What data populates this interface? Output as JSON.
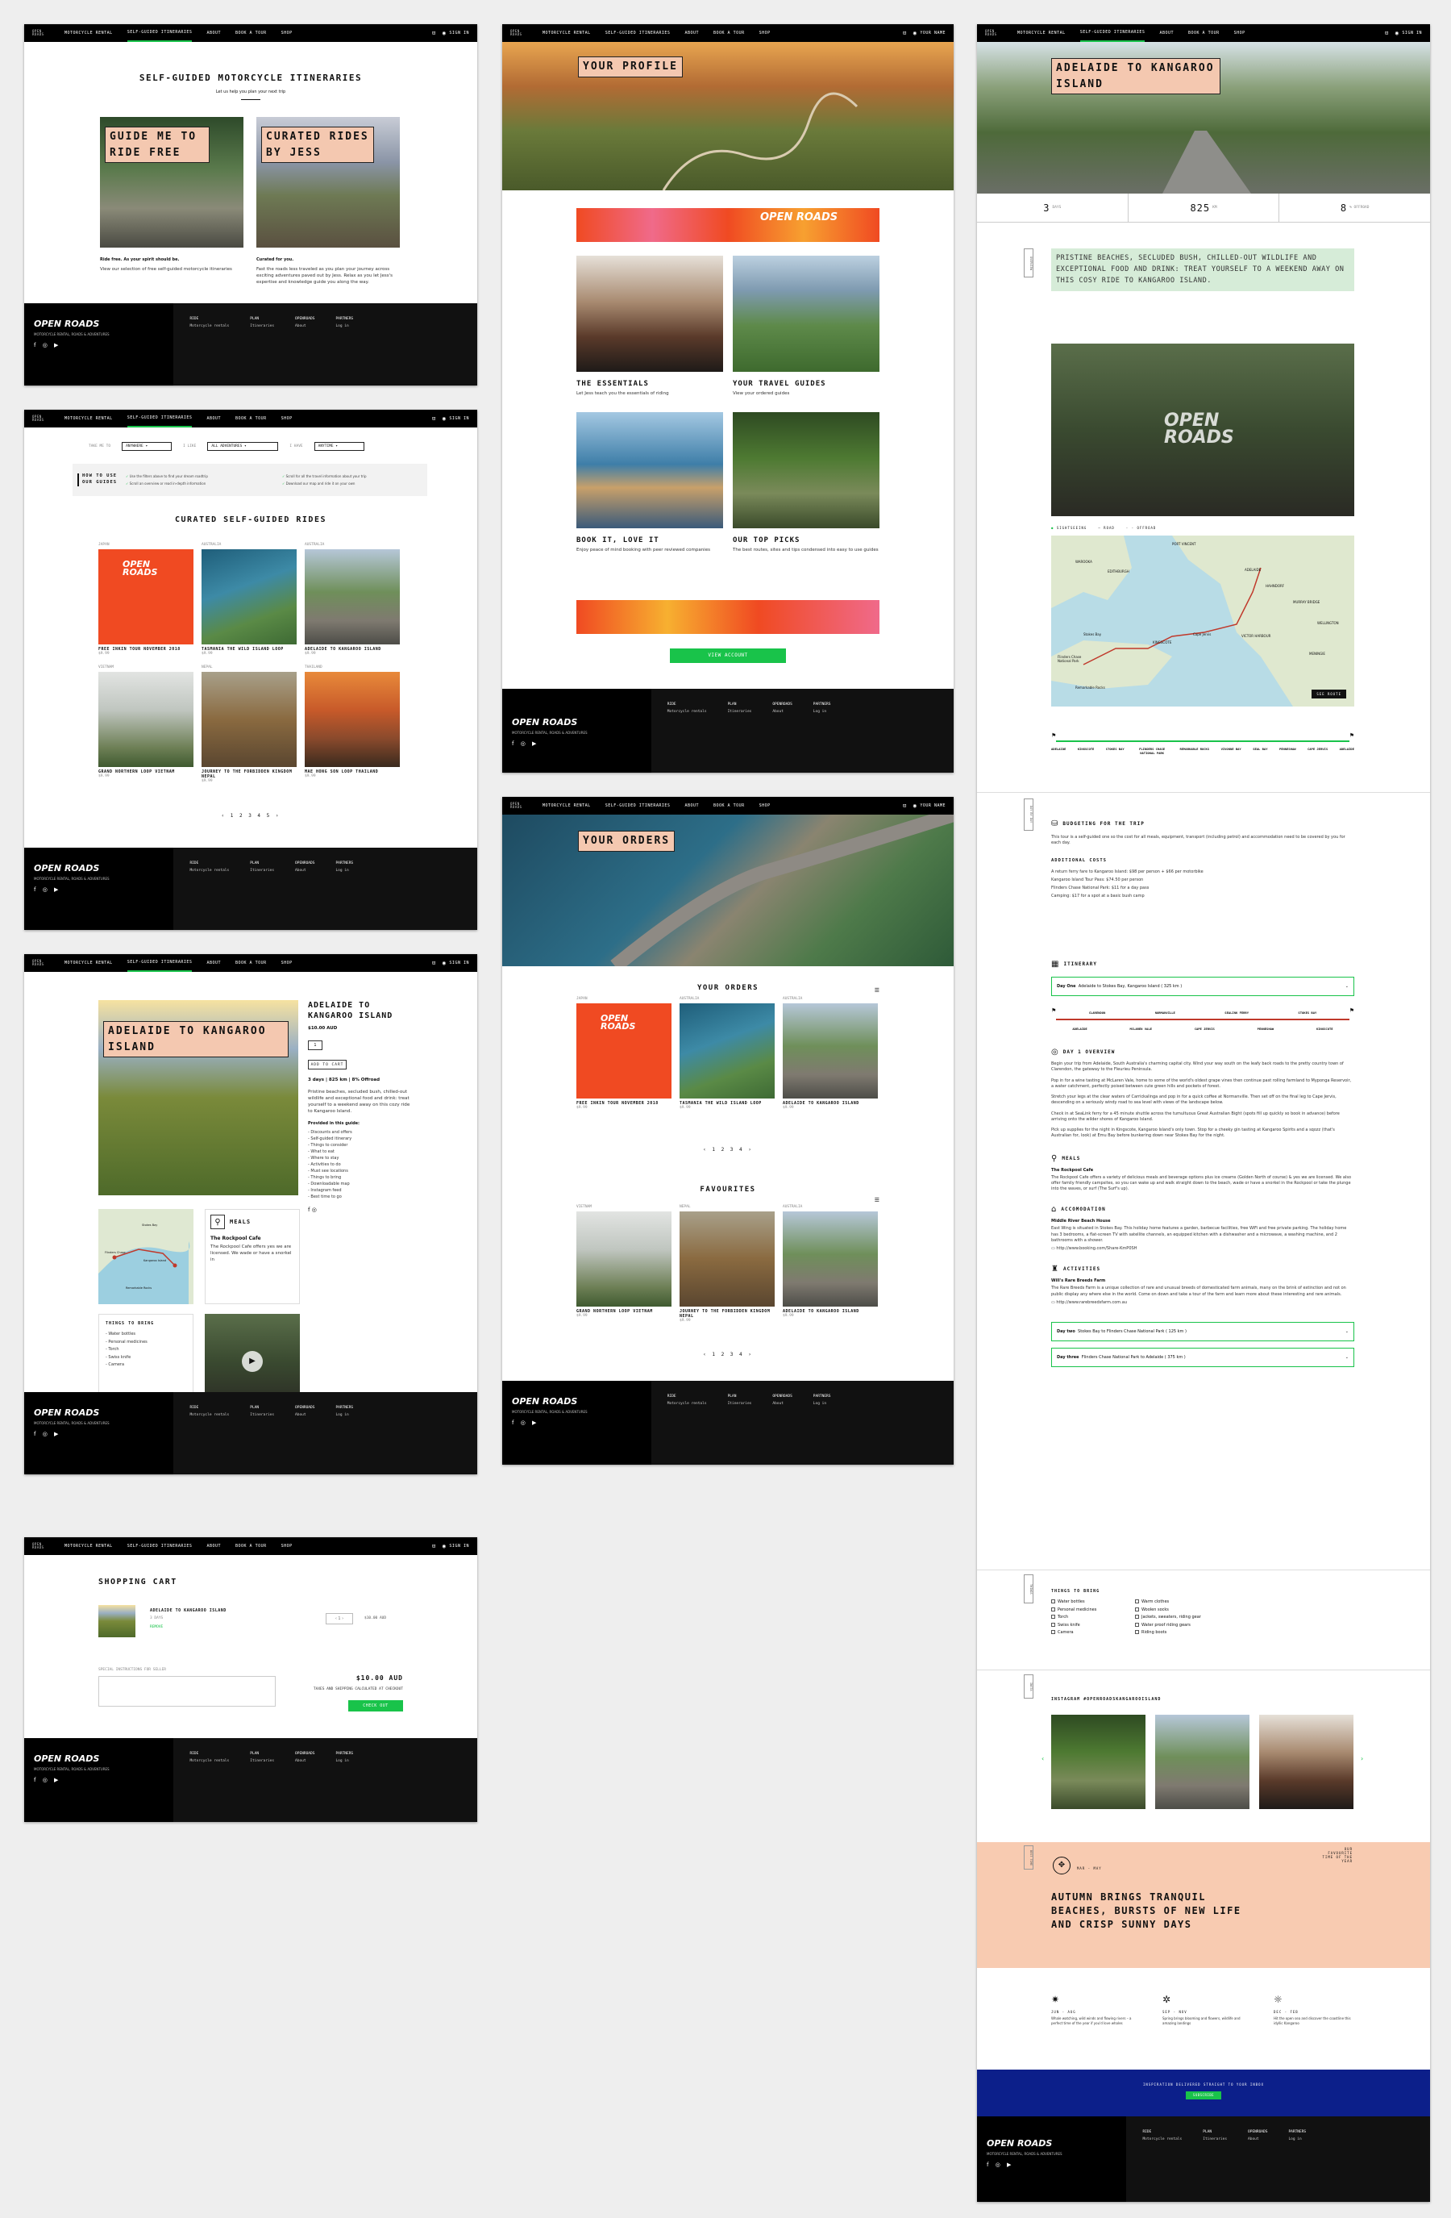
{
  "nav": {
    "brand": "OPEN ROADS",
    "items": [
      "MOTORCYCLE RENTAL",
      "SELF-GUIDED ITINERARIES",
      "ABOUT",
      "BOOK A TOUR",
      "SHOP"
    ],
    "sign_in": "SIGN IN",
    "your_name": "YOUR NAME"
  },
  "footer": {
    "logo": "OPEN ROADS",
    "tagline": "MOTORCYCLE RENTAL, ROADS & ADVENTURES",
    "socials": "f ◎ ▶",
    "cols": [
      {
        "head": "RIDE",
        "link": "Motorcycle rentals"
      },
      {
        "head": "PLAN",
        "link": "Itineraries"
      },
      {
        "head": "OPENROADS",
        "link": "About"
      },
      {
        "head": "PARTNERS",
        "link": "Log in"
      }
    ]
  },
  "s1": {
    "title": "SELF-GUIDED MOTORCYCLE ITINERARIES",
    "sub": "Let us help you plan your next trip",
    "card1_title": "GUIDE ME TO RIDE FREE",
    "card1_head": "Ride free. As your spirit should be.",
    "card1_text": "View our selection of free self-guided motorcycle itineraries",
    "card2_title": "CURATED RIDES BY JESS",
    "card2_head": "Curated for you.",
    "card2_text": "Fast the roads less traveled as you plan your journey across exciting adventures paved out by Jess. Relax as you let Jess's expertise and knowledge guide you along the way."
  },
  "s2": {
    "filter_label1": "TAKE ME TO",
    "filter_val1": "ANYWHERE",
    "filter_label2": "I LIKE",
    "filter_val2": "ALL ADVENTURES",
    "filter_label3": "I HAVE",
    "filter_val3": "ANYTIME",
    "howto_title": "HOW TO USE OUR GUIDES",
    "howto_items": [
      "Use the filters above to find your dream roadtrip",
      "Scroll an overview or read in-depth information",
      "Scroll for all the travel information about your trip",
      "Download our map and ride it on your own"
    ],
    "title": "CURATED SELF-GUIDED RIDES",
    "rides": [
      {
        "region": "JAPAN",
        "name": "FREE INKIN TOUR NOVEMBER 2018",
        "meta": "$9.99"
      },
      {
        "region": "AUSTRALIA",
        "name": "TASMANIA THE WILD ISLAND LOOP",
        "meta": "$9.99"
      },
      {
        "region": "AUSTRALIA",
        "name": "ADELAIDE TO KANGAROO ISLAND",
        "meta": "$9.99"
      },
      {
        "region": "VIETNAM",
        "name": "GRAND NORTHERN LOOP VIETNAM",
        "meta": "$9.99"
      },
      {
        "region": "NEPAL",
        "name": "JOURNEY TO THE FORBIDDEN KINGDOM NEPAL",
        "meta": "$9.99"
      },
      {
        "region": "THAILAND",
        "name": "MAE HONG SON LOOP THAILAND",
        "meta": "$9.99"
      }
    ],
    "pager": "‹ 1 2 3 4 5 ›"
  },
  "s3": {
    "hero_title": "ADELAIDE TO KANGAROO ISLAND",
    "title": "ADELAIDE TO KANGAROO ISLAND",
    "price": "$10.00 AUD",
    "qty": "1",
    "add_btn": "ADD TO CART",
    "stats": "3 days | 825 km | 8% Offroad",
    "desc": "Pristine beaches, secluded bush, chilled-out wildlife and exceptional food and drink: treat yourself to a weekend away on this cozy ride to Kangaroo Island.",
    "provided_title": "Provided in this guide:",
    "provided": [
      "Discounts and offers",
      "Self-guided itinerary",
      "Things to consider",
      "What to eat",
      "Where to stay",
      "Activities to do",
      "Must see locations",
      "Things to bring",
      "Downloadable map",
      "Instagram feed",
      "Best time to go"
    ],
    "meals_title": "MEALS",
    "meals_place": "The Rockpool Cafe",
    "meals_text": "The Rockpool Cafe offers yes we are licensed. We wade or have a snorkel in",
    "bring_title": "THINGS TO BRING",
    "bring": [
      "Water bottles",
      "Personal medicines",
      "Torch",
      "Swiss knife",
      "Camera"
    ],
    "map_labels": [
      "Stokes Bay",
      "Flinders Chase",
      "Kangaroo Island",
      "Remarkable Rocks"
    ]
  },
  "s4": {
    "title": "SHOPPING CART",
    "item_name": "ADELAIDE TO KANGAROO ISLAND",
    "item_days": "3 DAYS",
    "item_status": "REMOVE",
    "item_qty": "1",
    "item_price": "$10.00 AUD",
    "special_label": "SPECIAL INSTRUCTIONS FOR SELLER",
    "total": "$10.00 AUD",
    "tax_note": "TAXES AND SHIPPING CALCULATED AT CHECKOUT",
    "checkout": "CHECK OUT"
  },
  "s5": {
    "hero_title": "YOUR PROFILE",
    "cards": [
      {
        "title": "THE ESSENTIALS",
        "text": "Let Jess teach you the essentials of riding"
      },
      {
        "title": "YOUR TRAVEL GUIDES",
        "text": "View your ordered guides"
      },
      {
        "title": "BOOK IT, LOVE IT",
        "text": "Enjoy peace of mind booking with peer reviewed companies"
      },
      {
        "title": "OUR TOP PICKS",
        "text": "The best routes, sites and tips condensed into easy to use guides"
      }
    ],
    "banner_logo": "OPEN ROADS",
    "view_btn": "VIEW ACCOUNT"
  },
  "s6": {
    "hero_title": "YOUR ORDERS",
    "orders_title": "YOUR ORDERS",
    "orders": [
      {
        "region": "JAPAN",
        "name": "FREE INKIN TOUR NOVEMBER 2018",
        "meta": "$9.99"
      },
      {
        "region": "AUSTRALIA",
        "name": "TASMANIA THE WILD ISLAND LOOP",
        "meta": "$9.99"
      },
      {
        "region": "AUSTRALIA",
        "name": "ADELAIDE TO KANGAROO ISLAND",
        "meta": "$9.99"
      }
    ],
    "fav_title": "FAVOURITES",
    "favs": [
      {
        "region": "VIETNAM",
        "name": "GRAND NORTHERN LOOP VIETNAM",
        "meta": "$9.99"
      },
      {
        "region": "NEPAL",
        "name": "JOURNEY TO THE FORBIDDEN KINGDOM NEPAL",
        "meta": "$9.99"
      },
      {
        "region": "AUSTRALIA",
        "name": "ADELAIDE TO KANGAROO ISLAND",
        "meta": "$9.99"
      }
    ],
    "pager": "‹ 1 2 3 4 ›"
  },
  "s7": {
    "hero_title": "ADELAIDE TO KANGAROO ISLAND",
    "stat1": "3",
    "stat1_unit": "DAYS",
    "stat2": "825",
    "stat2_unit": "KM",
    "stat3": "8",
    "stat3_unit": "% OFFROAD",
    "intro": "PRISTINE BEACHES, SECLUDED BUSH, CHILLED-OUT WILDLIFE AND EXCEPTIONAL FOOD AND DRINK: TREAT YOURSELF TO A WEEKEND AWAY ON THIS COSY RIDE TO KANGAROO ISLAND.",
    "legend": [
      "SIGHTSEEING",
      "ROAD",
      "OFFROAD"
    ],
    "map_places": [
      "PORT VINCENT",
      "WAROOKA",
      "EDITHBURGH",
      "ADELAIDE",
      "HAHNDORF",
      "MURRAY BRIDGE",
      "WELLINGTON",
      "VICTOR HARBOUR",
      "MENINGIE",
      "KINGSCOTE",
      "Stokes Bay",
      "Cape Jervis",
      "Flinders Chase National Park",
      "Remarkable Rocks"
    ],
    "map_btn": "SEE ROUTE",
    "route": [
      "ADELAIDE",
      "KINGSCOTE",
      "STOKES BAY",
      "FLINDERS CHASE NATIONAL PARK",
      "REMARKABLE ROCKS",
      "VIVONNE BAY",
      "SEAL BAY",
      "PENNESHAW",
      "CAPE JERVIS",
      "ADELAIDE"
    ],
    "budget_title": "BUDGETING FOR THE TRIP",
    "budget_text": "This tour is a self-guided one so the cost for all meals, equipment, transport (including petrol) and accommodation need to be covered by you for each day.",
    "costs_title": "ADDITIONAL COSTS",
    "costs": [
      "A return ferry fare to Kangaroo Island: $98 per person + $66 per motorbike",
      "Kangaroo Island Tour Pass: $74.50 per person",
      "Flinders Chase National Park: $11 for a day pass",
      "Camping: $17 for a spot at a basic bush camp"
    ],
    "itin_title": "ITINERARY",
    "day1_label": "Day One",
    "day1_route": "Adelaide to Stokes Bay, Kangaroo Island ( 325 km )",
    "day1_stops": [
      "ADELAIDE",
      "CLARENDON",
      "MCLAREN VALE",
      "NORMANVILLE",
      "CAPE JERVIS",
      "PENNESHAW",
      "SEALINK FERRY",
      "KINGSCOTE",
      "STOKES BAY"
    ],
    "overview_title": "DAY 1 OVERVIEW",
    "overview_p": [
      "Begin your trip from Adelaide, South Australia's charming capital city. Wind your way south on the leafy back roads to the pretty country town of Clarendon, the gateway to the Fleurieu Peninsula.",
      "Pop in for a wine tasting at McLaren Vale, home to some of the world's oldest grape vines then continue past rolling farmland to Myponga Reservoir, a water catchment, perfectly poised between cute green hills and pockets of forest.",
      "Stretch your legs at the clear waters of Carrickalinga and pop in for a quick coffee at Normanville. Then set off on the final leg to Cape Jervis, descending on a seriously windy road to sea level with views of the landscape below.",
      "Check in at SeaLink ferry for a 45 minute shuttle across the tumultuous Great Australian Bight (spots fill up quickly so book in advance) before arriving onto the wilder shores of Kangaroo Island.",
      "Pick up supplies for the night in Kingscote, Kangaroo Island's only town. Stop for a cheeky gin tasting at Kangaroo Spirits and a sqozz (that's Australian for, look) at Emu Bay before bunkering down near Stokes Bay for the night."
    ],
    "meals_title": "MEALS",
    "meals_place": "The Rockpool Cafe",
    "meals_text": "The Rockpool Cafe offers a variety of delicious meals and beverage options plus ice creams (Golden North of course) & yes we are licensed. We also offer family friendly campsites, so you can wake up and walk straight down to the beach, wade or have a snorkel in the Rockpool or take the plunge into the waves, or surf (The Surf's up).",
    "acc_title": "ACCOMODATION",
    "acc_place": "Middle River Beach House",
    "acc_text": "East Wing is situated in Stokes Bay. This holiday home features a garden, barbecue facilities, free WiFi and free private parking. The holiday home has 3 bedrooms, a flat-screen TV with satellite channels, an equipped kitchen with a dishwasher and a microwave, a washing machine, and 2 bathrooms with a shower.",
    "acc_link": "http://www.booking.com/Share-KmP0SH",
    "act_title": "ACTIVITIES",
    "act_place": "Will's Rare Breeds Farm",
    "act_text": "The Rare Breeds Farm is a unique collection of rare and unusual breeds of domesticated farm animals, many on the brink of extinction and not on public display any where else in the world. Come on down and take a tour of the farm and learn more about these interesting and rare animals.",
    "act_link": "http://www.rarebreedsfarm.com.au",
    "day2_label": "Day two",
    "day2_route": "Stokes Bay to Flinders Chase National Park ( 125 km )",
    "day3_label": "Day three",
    "day3_route": "Flinders Chase National Park to Adelaide ( 375 km )",
    "bring_title": "THINGS TO BRING",
    "bring_left": [
      "Water bottles",
      "Personal medicines",
      "Torch",
      "Swiss knife",
      "Camera"
    ],
    "bring_right": [
      "Warm clothes",
      "Woolen socks",
      "Jackets, sweaters, riding gear",
      "Water proof riding gears",
      "Riding boots"
    ],
    "insta_title": "INSTAGRAM #OPENROADSKANGAROOISLAND",
    "season_tag": "OUR FAVOURITE TIME OF THE YEAR",
    "season_months": "MAR - MAY",
    "season_text": "AUTUMN BRINGS TRANQUIL BEACHES, BURSTS OF NEW LIFE AND CRISP SUNNY DAYS",
    "seasons": [
      {
        "icon": "✷",
        "months": "JUN - AUG",
        "text": "Whale watching, wild winds and flowing rivers – a perfect time of the year if you'd love whales"
      },
      {
        "icon": "✲",
        "months": "SEP - NOV",
        "text": "Spring brings blooming and flowers, wildlife and amazing landings"
      },
      {
        "icon": "☼",
        "months": "DEC - FEB",
        "text": "Hit the open sea and discover the coastline this idyllic Kangaroo"
      }
    ],
    "newsletter_text": "INSPIRATION DELIVERED STRAIGHT TO YOUR INBOX",
    "subscribe": "SUBSCRIBE",
    "side_tabs": [
      "OVERVIEW",
      "DAY BY DAY",
      "THINGS",
      "INSTA",
      "BEST TIME"
    ]
  },
  "colors": {
    "green": "#19c34a",
    "pink": "#f4c8b0",
    "navy": "#0c1f8a",
    "mint": "#d6ecd8"
  }
}
